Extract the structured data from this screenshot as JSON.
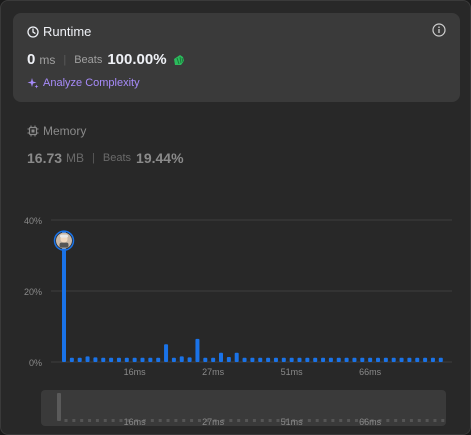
{
  "runtime": {
    "title": "Runtime",
    "value": "0",
    "unit": "ms",
    "separator": "|",
    "beats_label": "Beats",
    "beats_value": "100.00%",
    "analyze_label": "Analyze Complexity"
  },
  "memory": {
    "title": "Memory",
    "value": "16.73",
    "unit": "MB",
    "separator": "|",
    "beats_label": "Beats",
    "beats_value": "19.44%"
  },
  "colors": {
    "accent_bar": "#1a73e8",
    "analyze": "#a78bfa",
    "emoji": "#2cbb5d"
  },
  "chart_data": {
    "type": "bar",
    "y_ticks": [
      "40%",
      "20%",
      "0%"
    ],
    "ylim": [
      0,
      40
    ],
    "x_ticks": [
      "16ms",
      "27ms",
      "51ms",
      "66ms"
    ],
    "values": [
      37,
      1.2,
      1.2,
      1.6,
      1.3,
      1.2,
      1.2,
      1.2,
      1.2,
      1.2,
      1.2,
      1.2,
      1.2,
      5,
      1.2,
      1.6,
      1.3,
      6.5,
      1.2,
      1.2,
      2.6,
      1.4,
      2.6,
      1.2,
      1.2,
      1.2,
      1.2,
      1.2,
      1.2,
      1.2,
      1.2,
      1.2,
      1.2,
      1.2,
      1.2,
      1.2,
      1.2,
      1.2,
      1.2,
      1.2,
      1.2,
      1.2,
      1.2,
      1.2,
      1.2,
      1.2,
      1.2,
      1.2,
      1.2
    ],
    "highlight_index": 0,
    "navigator_x_ticks": [
      "16ms",
      "27ms",
      "51ms",
      "66ms"
    ]
  }
}
